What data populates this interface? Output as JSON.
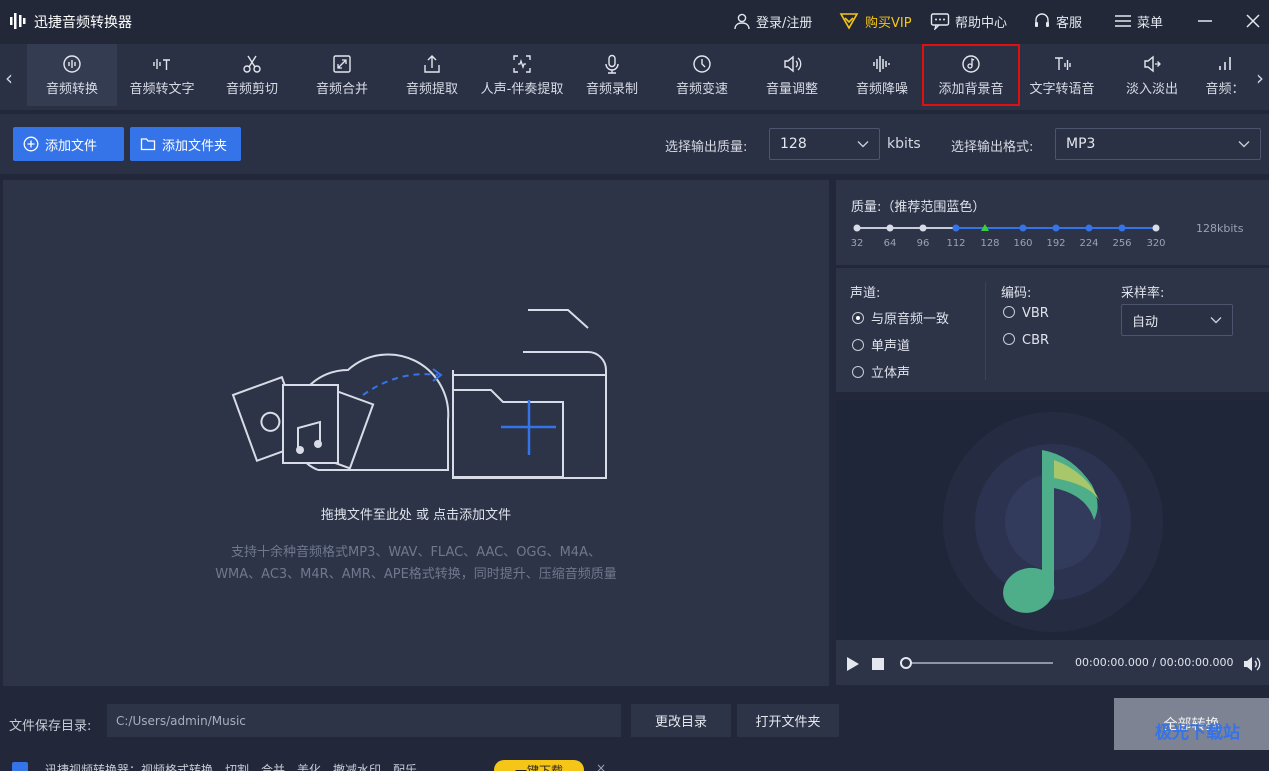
{
  "app": {
    "title": "迅捷音频转换器"
  },
  "titlebar": {
    "login": "登录/注册",
    "vip": "购买VIP",
    "help": "帮助中心",
    "service": "客服",
    "menu": "菜单"
  },
  "toolbar": {
    "tools": [
      {
        "label": "音频转换",
        "icon": "audio-convert-icon"
      },
      {
        "label": "音频转文字",
        "icon": "audio-to-text-icon"
      },
      {
        "label": "音频剪切",
        "icon": "scissors-icon"
      },
      {
        "label": "音频合并",
        "icon": "merge-icon"
      },
      {
        "label": "音频提取",
        "icon": "upload-icon"
      },
      {
        "label": "人声-伴奏提取",
        "icon": "voice-extract-icon"
      },
      {
        "label": "音频录制",
        "icon": "microphone-icon"
      },
      {
        "label": "音频变速",
        "icon": "speed-icon"
      },
      {
        "label": "音量调整",
        "icon": "volume-icon"
      },
      {
        "label": "音频降噪",
        "icon": "noise-icon"
      },
      {
        "label": "添加背景音",
        "icon": "bgm-icon"
      },
      {
        "label": "文字转语音",
        "icon": "text-to-speech-icon"
      },
      {
        "label": "淡入淡出",
        "icon": "fade-icon"
      },
      {
        "label": "音频：",
        "icon": "bars-icon"
      }
    ]
  },
  "options": {
    "add_file": "添加文件",
    "add_folder": "添加文件夹",
    "quality_label": "选择输出质量:",
    "quality_value": "128",
    "quality_unit": "kbits",
    "format_label": "选择输出格式:",
    "format_value": "MP3"
  },
  "drop": {
    "hint": "拖拽文件至此处 或 点击添加文件",
    "desc_line1": "支持十余种音频格式MP3、WAV、FLAC、AAC、OGG、M4A、",
    "desc_line2": "WMA、AC3、M4R、AMR、APE格式转换，同时提升、压缩音频质量"
  },
  "quality": {
    "title": "质量:（推荐范围蓝色）",
    "ticks": [
      "32",
      "64",
      "96",
      "112",
      "128",
      "160",
      "192",
      "224",
      "256",
      "320"
    ],
    "current": "128kbits",
    "selected_index": 4
  },
  "settings": {
    "channel_label": "声道:",
    "channel_options": [
      "与原音频一致",
      "单声道",
      "立体声"
    ],
    "encode_label": "编码:",
    "encode_options": [
      "VBR",
      "CBR"
    ],
    "sample_label": "采样率:",
    "sample_value": "自动"
  },
  "player": {
    "time": "00:00:00.000 / 00:00:00.000"
  },
  "bottom": {
    "save_label": "文件保存目录:",
    "save_path": "C:/Users/admin/Music",
    "change_dir": "更改目录",
    "open_folder": "打开文件夹",
    "convert_all": "全部转换",
    "promo": "迅捷视频转换器：视频格式转换、切割、合并、美化、撤减水印、配乐",
    "download": "一键下载",
    "watermark": "极光下载站"
  },
  "colors": {
    "accent": "#3574e8",
    "vip": "#f5c518",
    "highlight": "#e01010"
  }
}
